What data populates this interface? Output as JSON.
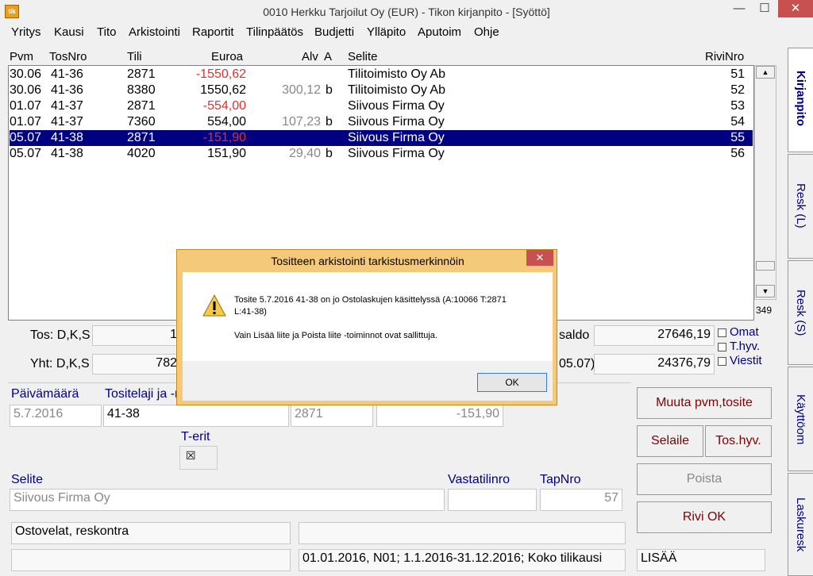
{
  "window": {
    "title": "0010  Herkku Tarjoilut Oy (EUR) - Tikon kirjanpito - [Syöttö]",
    "icon_text": "tik",
    "min": "—",
    "max": "☐",
    "close": "✕"
  },
  "menu": [
    "Yritys",
    "Kausi",
    "Tito",
    "Arkistointi",
    "Raportit",
    "Tilinpäätös",
    "Budjetti",
    "Ylläpito",
    "Aputoim",
    "Ohje"
  ],
  "grid": {
    "headers": {
      "pvm": "Pvm",
      "tosnro": "TosNro",
      "tili": "Tili",
      "euroa": "Euroa",
      "alv": "Alv",
      "a": "A",
      "selite": "Selite",
      "rivinro": "RiviNro"
    },
    "rows": [
      {
        "pvm": "30.06",
        "tosnro": "41-36",
        "tili": "2871",
        "euroa": "-1550,62",
        "alv": "",
        "a": "",
        "selite": "Tilitoimisto Oy Ab",
        "rivinro": "51"
      },
      {
        "pvm": "30.06",
        "tosnro": "41-36",
        "tili": "8380",
        "euroa": "1550,62",
        "alv": "300,12",
        "a": "b",
        "selite": "Tilitoimisto Oy Ab",
        "rivinro": "52"
      },
      {
        "pvm": "01.07",
        "tosnro": "41-37",
        "tili": "2871",
        "euroa": "-554,00",
        "alv": "",
        "a": "",
        "selite": "Siivous Firma Oy",
        "rivinro": "53"
      },
      {
        "pvm": "01.07",
        "tosnro": "41-37",
        "tili": "7360",
        "euroa": "554,00",
        "alv": "107,23",
        "a": "b",
        "selite": "Siivous Firma Oy",
        "rivinro": "54"
      },
      {
        "pvm": "05.07",
        "tosnro": "41-38",
        "tili": "2871",
        "euroa": "-151,90",
        "alv": "",
        "a": "",
        "selite": "Siivous Firma Oy",
        "rivinro": "55"
      },
      {
        "pvm": "05.07",
        "tosnro": "41-38",
        "tili": "4020",
        "euroa": "151,90",
        "alv": "29,40",
        "a": "b",
        "selite": "Siivous Firma Oy",
        "rivinro": "56"
      }
    ],
    "row_count": "349"
  },
  "totals": {
    "tos_label": "Tos: D,K,S",
    "yht_label": "Yht: D,K,S",
    "tos_value_partial": "1",
    "yht_value_partial": "782",
    "saldo_label": "saldo",
    "saldo_value": "27646,19",
    "date_label_partial": "05.07)",
    "date_value": "24376,79",
    "checks": [
      "Omat",
      "T.hyv.",
      "Viestit"
    ]
  },
  "entry": {
    "paivamaara_label": "Päivämäärä",
    "paivamaara_value": "5.7.2016",
    "tositelaji_label": "Tositelaji ja -n",
    "tositelaji_value": "41-38",
    "tili_value": "2871",
    "summa_value": "-151,90",
    "terit_label": "T-erit",
    "terit_check": "☒",
    "selite_label": "Selite",
    "selite_value": "Siivous Firma Oy",
    "vastatili_label": "Vastatilinro",
    "vastatili_value": "",
    "tapnro_label": "TapNro",
    "tapnro_value": "57",
    "account_name": "Ostovelat, reskontra",
    "period_info": "01.01.2016, N01; 1.1.2016-31.12.2016; Koko tilikausi",
    "mode": "LISÄÄ"
  },
  "buttons": {
    "muuta": "Muuta pvm,tosite",
    "selaile": "Selaile",
    "toshyv": "Tos.hyv.",
    "poista": "Poista",
    "riviok": "Rivi OK"
  },
  "tabs": [
    "Kirjanpito",
    "Resk (L)",
    "Resk (S)",
    "Käyttöom",
    "Laskuresk"
  ],
  "dialog": {
    "title": "Tositteen arkistointi tarkistusmerkinnöin",
    "line1": "Tosite 5.7.2016 41-38 on jo Ostolaskujen käsittelyssä (A:10066 T:2871",
    "line2": "L:41-38)",
    "line3": "Vain Lisää liite ja Poista liite -toiminnot ovat sallittuja.",
    "ok": "OK",
    "close": "✕"
  },
  "colors": {
    "selection": "#000080",
    "negative": "#e03030",
    "dialog_frame": "#f5c97a"
  }
}
